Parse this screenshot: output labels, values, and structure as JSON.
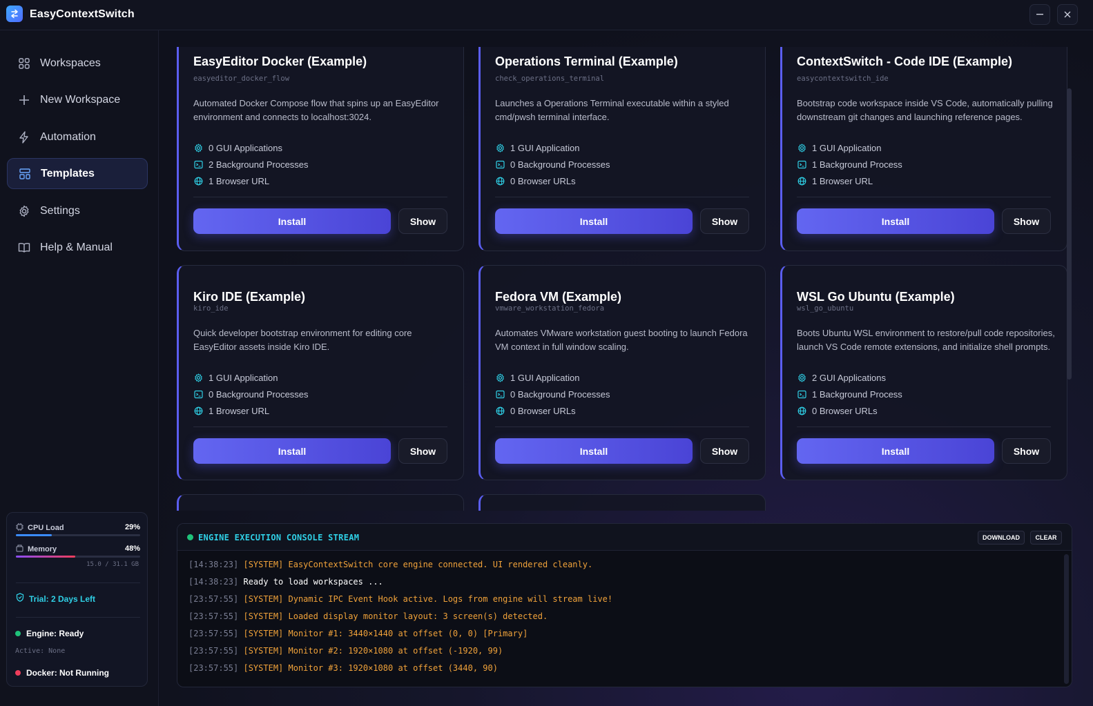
{
  "app": {
    "title": "EasyContextSwitch"
  },
  "window": {
    "minimize": "–",
    "close": "✕"
  },
  "sidebar": {
    "items": [
      {
        "label": "Workspaces",
        "icon": "grid-icon",
        "active": false
      },
      {
        "label": "New Workspace",
        "icon": "plus-icon",
        "active": false
      },
      {
        "label": "Automation",
        "icon": "bolt-icon",
        "active": false
      },
      {
        "label": "Templates",
        "icon": "template-icon",
        "active": true
      },
      {
        "label": "Settings",
        "icon": "gear-icon",
        "active": false
      },
      {
        "label": "Help & Manual",
        "icon": "book-icon",
        "active": false
      }
    ],
    "stats": {
      "cpu_label": "CPU Load",
      "cpu_value": "29%",
      "cpu_fraction": 0.29,
      "mem_label": "Memory",
      "mem_value": "48%",
      "mem_fraction": 0.48,
      "mem_detail": "15.0 / 31.1 GB",
      "trial": "Trial: 2 Days Left",
      "engine": "Engine: Ready",
      "active": "Active: None",
      "docker": "Docker: Not Running"
    }
  },
  "cards": [
    {
      "title": "EasyEditor Docker (Example)",
      "id": "easyeditor_docker_flow",
      "desc": "Automated Docker Compose flow that spins up an EasyEditor environment and connects to localhost:3024.",
      "gui": "0 GUI Applications",
      "bg": "2 Background Processes",
      "urls": "1 Browser URL",
      "install": "Install",
      "show": "Show"
    },
    {
      "title": "Operations Terminal (Example)",
      "id": "check_operations_terminal",
      "desc": "Launches a Operations Terminal executable within a styled cmd/pwsh terminal interface.",
      "gui": "1 GUI Application",
      "bg": "0 Background Processes",
      "urls": "0 Browser URLs",
      "install": "Install",
      "show": "Show"
    },
    {
      "title": "ContextSwitch - Code IDE (Example)",
      "id": "easycontextswitch_ide",
      "desc": "Bootstrap code workspace inside VS Code, automatically pulling downstream git changes and launching reference pages.",
      "gui": "1 GUI Application",
      "bg": "1 Background Process",
      "urls": "1 Browser URL",
      "install": "Install",
      "show": "Show"
    },
    {
      "title": "Kiro IDE (Example)",
      "id": "kiro_ide",
      "desc": "Quick developer bootstrap environment for editing core EasyEditor assets inside Kiro IDE.",
      "gui": "1 GUI Application",
      "bg": "0 Background Processes",
      "urls": "1 Browser URL",
      "install": "Install",
      "show": "Show"
    },
    {
      "title": "Fedora VM (Example)",
      "id": "vmware_workstation_fedora",
      "desc": "Automates VMware workstation guest booting to launch Fedora VM context in full window scaling.",
      "gui": "1 GUI Application",
      "bg": "0 Background Processes",
      "urls": "0 Browser URLs",
      "install": "Install",
      "show": "Show"
    },
    {
      "title": "WSL Go Ubuntu (Example)",
      "id": "wsl_go_ubuntu",
      "desc": "Boots Ubuntu WSL environment to restore/pull code repositories, launch VS Code remote extensions, and initialize shell prompts.",
      "gui": "2 GUI Applications",
      "bg": "1 Background Process",
      "urls": "0 Browser URLs",
      "install": "Install",
      "show": "Show"
    }
  ],
  "console": {
    "title": "ENGINE EXECUTION CONSOLE STREAM",
    "download": "DOWNLOAD",
    "clear": "CLEAR",
    "lines": [
      {
        "ts": "[14:38:23]",
        "msg": "[SYSTEM] EasyContextSwitch core engine connected. UI rendered cleanly.",
        "kind": "sys"
      },
      {
        "ts": "[14:38:23]",
        "msg": "Ready to load workspaces ...",
        "kind": "ready"
      },
      {
        "ts": "[23:57:55]",
        "msg": "[SYSTEM] Dynamic IPC Event Hook active. Logs from engine will stream live!",
        "kind": "sys"
      },
      {
        "ts": "[23:57:55]",
        "msg": "[SYSTEM] Loaded display monitor layout: 3 screen(s) detected.",
        "kind": "sys"
      },
      {
        "ts": "[23:57:55]",
        "msg": "[SYSTEM] Monitor #1: 3440×1440 at offset (0, 0) [Primary]",
        "kind": "sys"
      },
      {
        "ts": "[23:57:55]",
        "msg": "[SYSTEM] Monitor #2: 1920×1080 at offset (-1920, 99)",
        "kind": "sys"
      },
      {
        "ts": "[23:57:55]",
        "msg": "[SYSTEM] Monitor #3: 1920×1080 at offset (3440, 90)",
        "kind": "sys"
      }
    ]
  },
  "colors": {
    "accent": "#6366f1",
    "cyan": "#2fd0e6",
    "ready": "#1fc27a",
    "danger": "#ef3d5b",
    "log_system": "#f0a23a"
  }
}
